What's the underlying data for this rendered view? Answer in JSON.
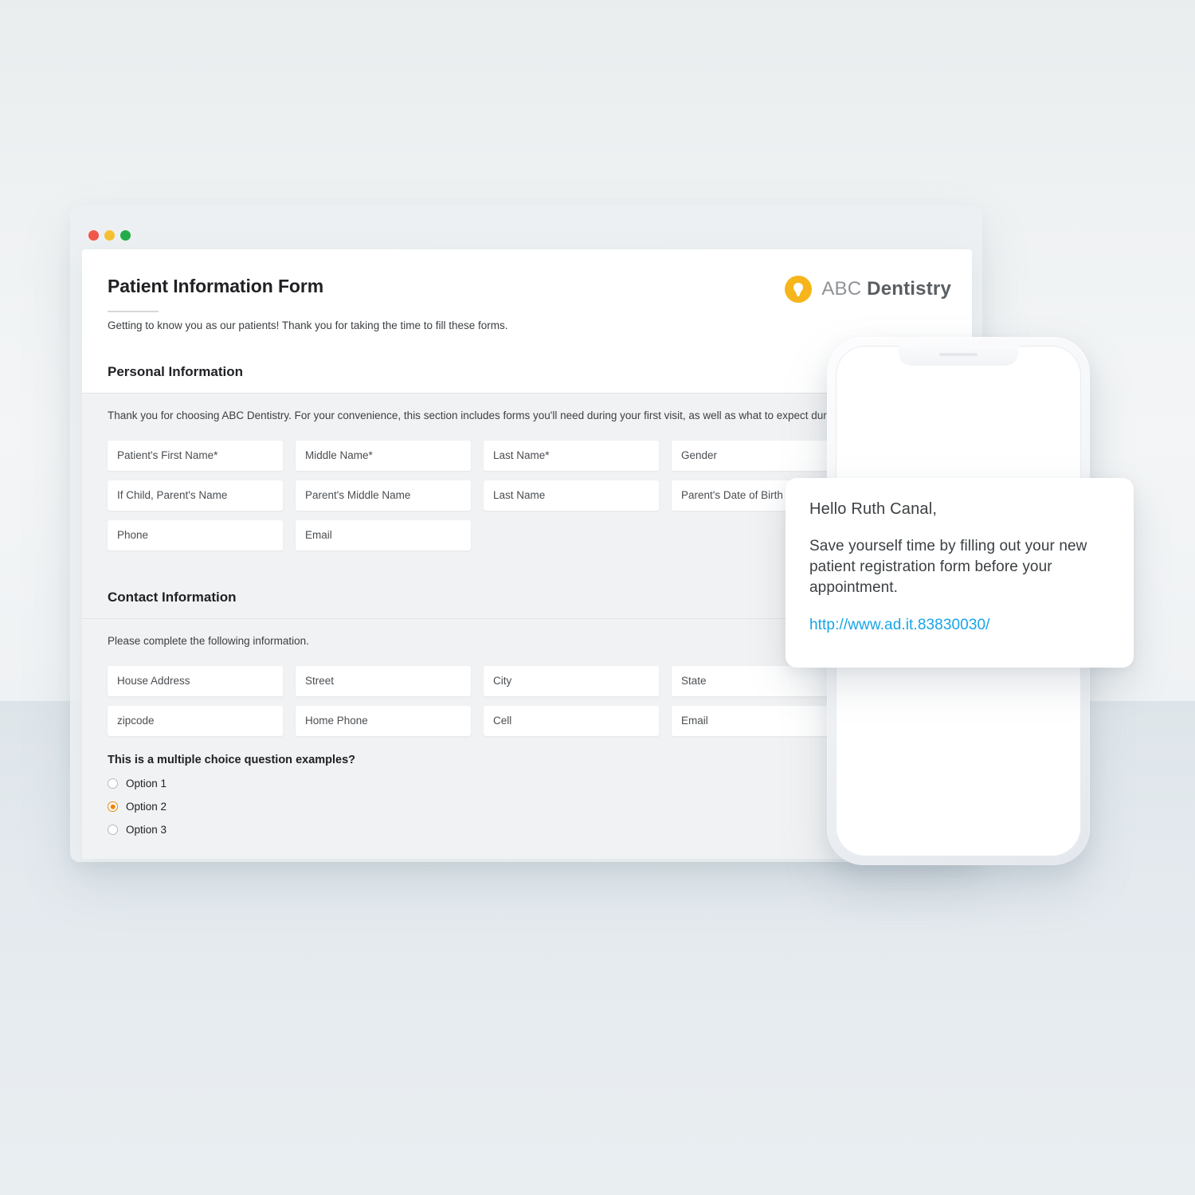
{
  "window": {
    "dots": [
      {
        "name": "close",
        "color": "#f2574a"
      },
      {
        "name": "minimize",
        "color": "#f6c033"
      },
      {
        "name": "maximize",
        "color": "#23ad4a"
      }
    ]
  },
  "form": {
    "title": "Patient Information Form",
    "subtitle": "Getting to know you as our patients! Thank you for taking the time to fill these forms.",
    "brand": {
      "light_word": "ABC",
      "bold_word": "Dentistry",
      "mark_color": "#f5b51b",
      "mark_icon": "tooth-icon"
    },
    "sections": [
      {
        "id": "personal",
        "title": "Personal Information",
        "description": "Thank you for choosing ABC Dentistry. For your convenience, this section includes forms you'll need during your first visit, as well as what to expect during your appointment.",
        "fields": [
          "Patient's First Name*",
          "Middle Name*",
          "Last Name*",
          "Gender",
          "If Child, Parent's Name",
          "Parent's Middle Name",
          "Last Name",
          "Parent's Date of Birth",
          "Phone",
          "Email"
        ]
      },
      {
        "id": "contact",
        "title": "Contact Information",
        "description": "Please complete the following information.",
        "fields": [
          "House Address",
          "Street",
          "City",
          "State",
          "zipcode",
          "Home Phone",
          "Cell",
          "Email"
        ]
      }
    ],
    "multiple_choice": {
      "question": "This is a multiple choice question examples?",
      "selected_index": 1,
      "accent_color": "#e8870b",
      "options": [
        "Option 1",
        "Option 2",
        "Option 3"
      ]
    }
  },
  "notification": {
    "greeting": "Hello Ruth Canal,",
    "body": "Save yourself time by filling out your new patient registration form before your appointment.",
    "link": "http://www.ad.it.83830030/",
    "link_color": "#17a5e8"
  }
}
